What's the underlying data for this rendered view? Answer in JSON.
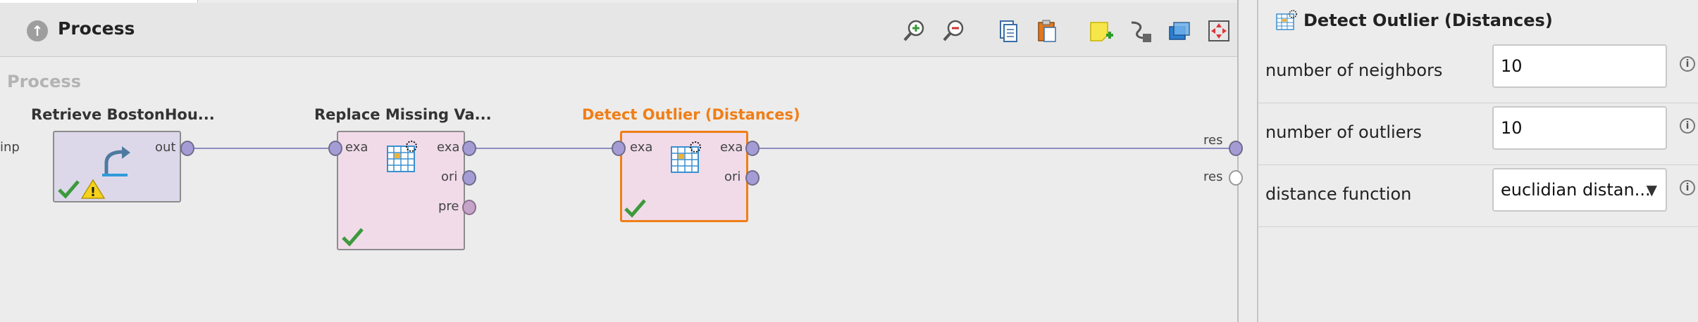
{
  "header": {
    "title": "Process",
    "icon": "up-arrow-icon"
  },
  "toolbar": [
    {
      "name": "zoom-in-icon"
    },
    {
      "name": "zoom-out-icon"
    },
    {
      "name": "copy-icon"
    },
    {
      "name": "paste-icon"
    },
    {
      "name": "add-note-icon"
    },
    {
      "name": "auto-wire-icon"
    },
    {
      "name": "layers-icon"
    },
    {
      "name": "fit-view-icon"
    }
  ],
  "canvas": {
    "label": "Process",
    "left_port_label": "inp",
    "right_ports": [
      "res",
      "res"
    ]
  },
  "operators": [
    {
      "title": "Retrieve BostonHou...",
      "out_ports": [
        "out"
      ],
      "in_ports": [],
      "status": "ok-with-warning"
    },
    {
      "title": "Replace Missing Va...",
      "in_ports": [
        "exa"
      ],
      "out_ports": [
        "exa",
        "ori",
        "pre"
      ],
      "status": "ok"
    },
    {
      "title": "Detect Outlier (Distances)",
      "in_ports": [
        "exa"
      ],
      "out_ports": [
        "exa",
        "ori"
      ],
      "status": "ok",
      "selected": true
    }
  ],
  "params": {
    "title": "Detect Outlier (Distances)",
    "rows": [
      {
        "label": "number of neighbors",
        "value": "10",
        "type": "text"
      },
      {
        "label": "number of outliers",
        "value": "10",
        "type": "text"
      },
      {
        "label": "distance function",
        "value": "euclidian distan...",
        "type": "select"
      }
    ]
  },
  "colors": {
    "selected_title": "#f07e16",
    "selected_border": "#f07e16",
    "retrieve_fill": "#dcd8ea",
    "operator_fill": "#f1dbe9",
    "port_exa": "#a59cd6",
    "port_pre": "#c6a3c9",
    "connection": "#8d8dc0"
  }
}
